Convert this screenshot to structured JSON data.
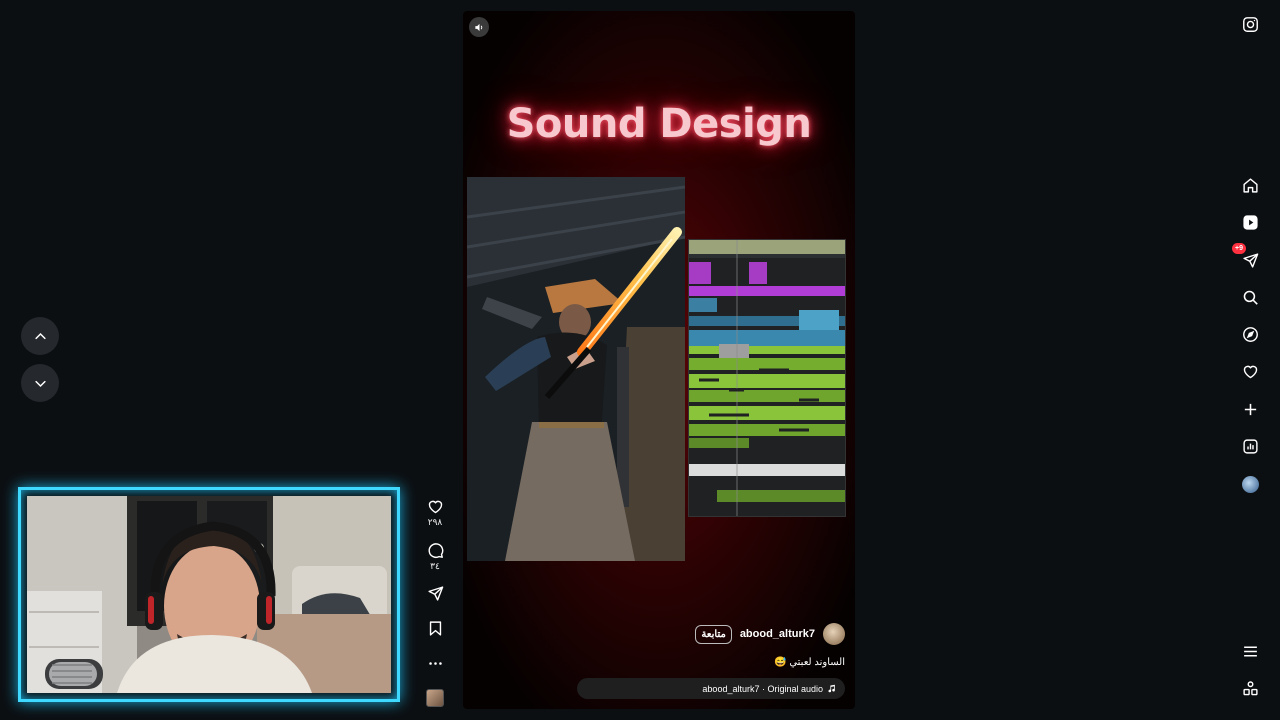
{
  "reel": {
    "title_overlay": "Sound Design",
    "username": "abood_alturk7",
    "follow_label": "متابعة",
    "caption": "الساوند لعبتي 😅",
    "audio_label": "abood_alturk7 · Original audio"
  },
  "actions": {
    "likes": "٢٩٨",
    "comments": "٣٤"
  },
  "sidebar": {
    "notification_count": "+9",
    "items": [
      "instagram-icon",
      "home-icon",
      "reels-icon",
      "messages-icon",
      "search-icon",
      "explore-icon",
      "heart-icon",
      "create-icon",
      "dashboard-icon",
      "profile-avatar",
      "menu-icon",
      "more-apps-icon"
    ]
  },
  "colors": {
    "background": "#0c0f12",
    "webcam_border": "#3fd9ff",
    "title_glow": "#e8243d",
    "badge": "#ff3040"
  }
}
